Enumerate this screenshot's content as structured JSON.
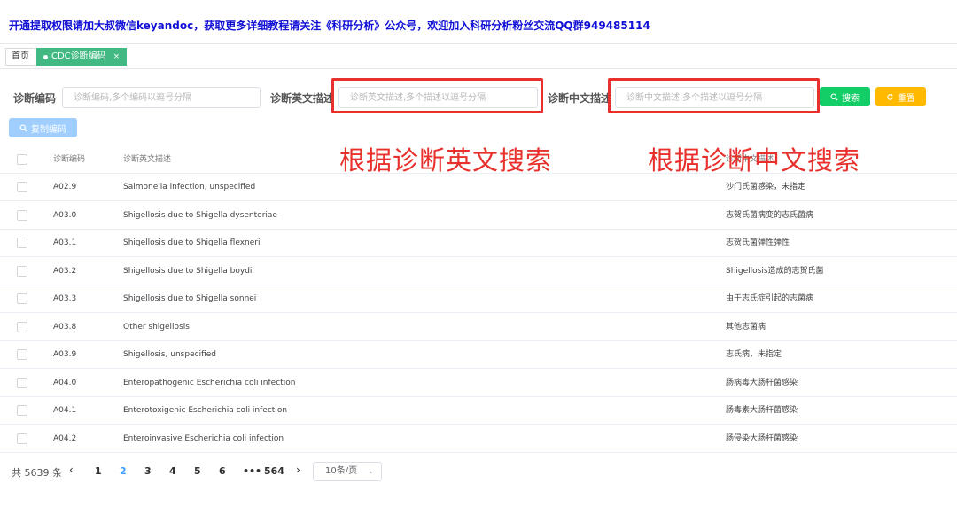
{
  "notice": "开通提取权限请加大叔微信keyandoc，获取更多详细教程请关注《科研分析》公众号，欢迎加入科研分析粉丝交流QQ群949485114",
  "tabs": {
    "home": "首页",
    "active": "CDC诊断编码",
    "close": "×"
  },
  "search": {
    "code_label": "诊断编码",
    "code_placeholder": "诊断编码,多个编码以逗号分隔",
    "en_label": "诊断英文描述",
    "en_placeholder": "诊断英文描述,多个描述以逗号分隔",
    "cn_label": "诊断中文描述",
    "cn_placeholder": "诊断中文描述,多个描述以逗号分隔",
    "search_button": "搜索",
    "reset_button": "重置",
    "copy_button": "复制编码"
  },
  "annotations": {
    "en": "根据诊断英文搜索",
    "cn": "根据诊断中文搜索"
  },
  "table": {
    "headers": {
      "code": "诊断编码",
      "en": "诊断英文描述",
      "cn": "诊断中文描述"
    },
    "rows": [
      {
        "code": "A02.9",
        "en": "Salmonella infection, unspecified",
        "cn": "沙门氏菌感染，未指定"
      },
      {
        "code": "A03.0",
        "en": "Shigellosis due to Shigella dysenteriae",
        "cn": "志贺氏菌病变的志氏菌病"
      },
      {
        "code": "A03.1",
        "en": "Shigellosis due to Shigella flexneri",
        "cn": "志贺氏菌弹性弹性"
      },
      {
        "code": "A03.2",
        "en": "Shigellosis due to Shigella boydii",
        "cn": "Shigellosis造成的志贺氏菌"
      },
      {
        "code": "A03.3",
        "en": "Shigellosis due to Shigella sonnei",
        "cn": "由于志氏症引起的志菌病"
      },
      {
        "code": "A03.8",
        "en": "Other shigellosis",
        "cn": "其他志菌病"
      },
      {
        "code": "A03.9",
        "en": "Shigellosis, unspecified",
        "cn": "志氏病，未指定"
      },
      {
        "code": "A04.0",
        "en": "Enteropathogenic Escherichia coli infection",
        "cn": "肠病毒大肠杆菌感染"
      },
      {
        "code": "A04.1",
        "en": "Enterotoxigenic Escherichia coli infection",
        "cn": "肠毒素大肠杆菌感染"
      },
      {
        "code": "A04.2",
        "en": "Enteroinvasive Escherichia coli infection",
        "cn": "肠侵染大肠杆菌感染"
      }
    ]
  },
  "pagination": {
    "total": "共 5639 条",
    "pages": [
      "1",
      "2",
      "3",
      "4",
      "5",
      "6"
    ],
    "current_page": "2",
    "ellipsis": "•••",
    "last": "564",
    "prev": "‹",
    "next": "›",
    "page_size": "10条/页"
  },
  "colors": {
    "notice": "#0f0fd6",
    "tab_active": "#42b983",
    "search_button": "#13ce66",
    "reset_button": "#ffba00",
    "copy_button": "#a0cfff",
    "annotation": "#e8302c",
    "active_page": "#409eff"
  },
  "icons": {
    "search": "search-icon",
    "reset": "refresh-icon",
    "copy": "search-icon",
    "dropdown": "chevron-down-icon"
  }
}
